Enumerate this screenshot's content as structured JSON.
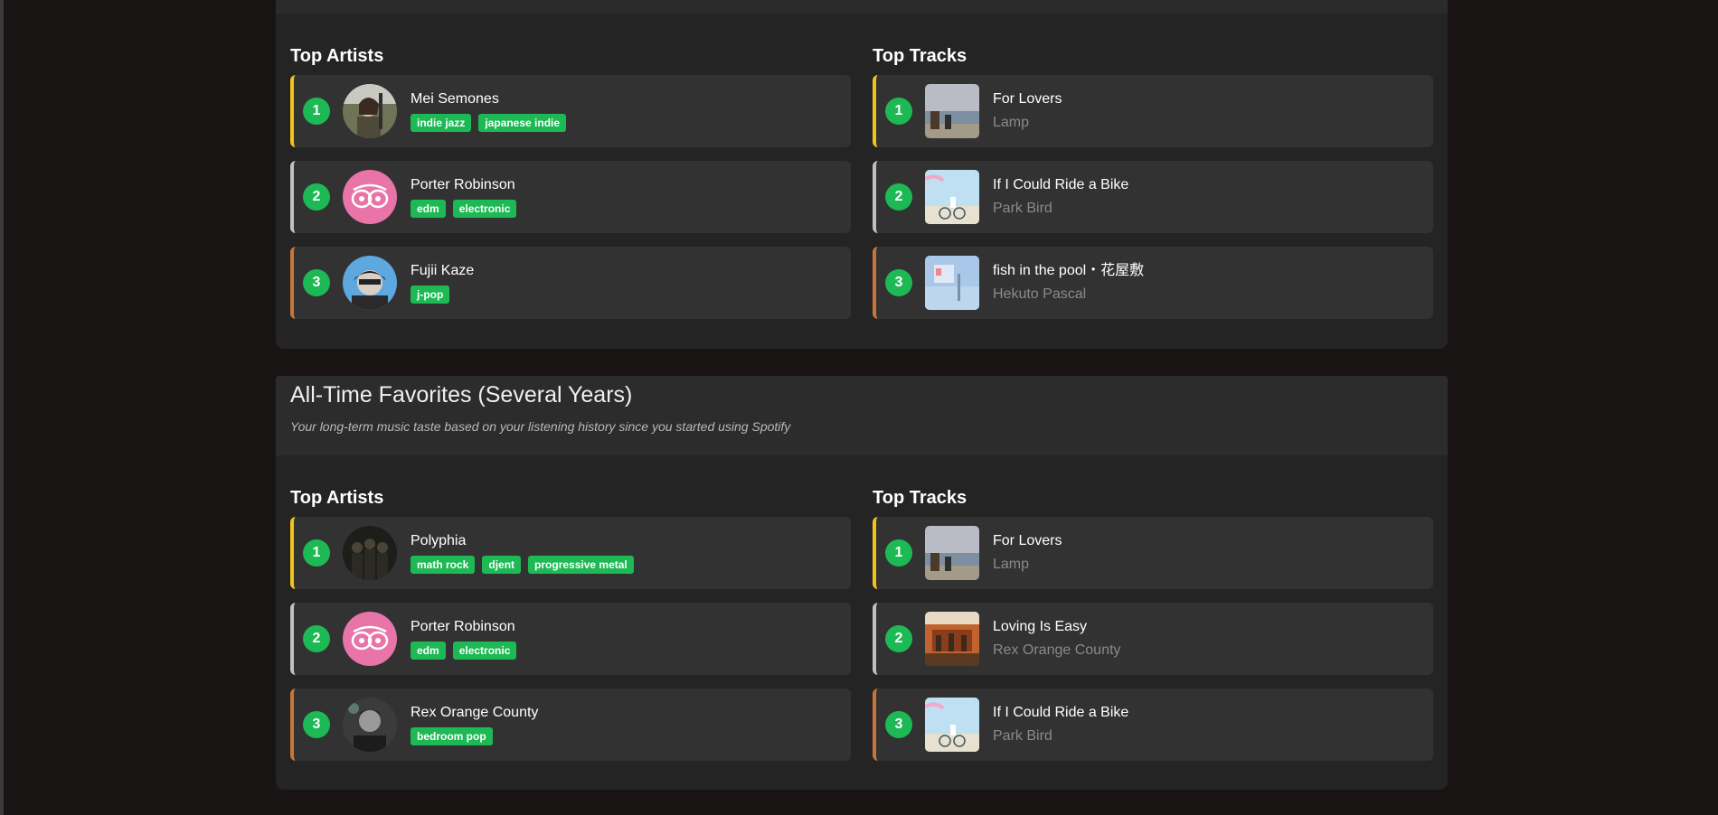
{
  "sections": [
    {
      "title": "",
      "subtitle": "",
      "artists_title": "Top Artists",
      "tracks_title": "Top Tracks",
      "artists": [
        {
          "rank": "1",
          "name": "Mei Semones",
          "tags": [
            "indie jazz",
            "japanese indie"
          ]
        },
        {
          "rank": "2",
          "name": "Porter Robinson",
          "tags": [
            "edm",
            "electronic"
          ]
        },
        {
          "rank": "3",
          "name": "Fujii Kaze",
          "tags": [
            "j-pop"
          ]
        }
      ],
      "tracks": [
        {
          "rank": "1",
          "title": "For Lovers",
          "artist": "Lamp"
        },
        {
          "rank": "2",
          "title": "If I Could Ride a Bike",
          "artist": "Park Bird"
        },
        {
          "rank": "3",
          "title": "fish in the pool・花屋敷",
          "artist": "Hekuto Pascal"
        }
      ]
    },
    {
      "title": "All-Time Favorites (Several Years)",
      "subtitle": "Your long-term music taste based on your listening history since you started using Spotify",
      "artists_title": "Top Artists",
      "tracks_title": "Top Tracks",
      "artists": [
        {
          "rank": "1",
          "name": "Polyphia",
          "tags": [
            "math rock",
            "djent",
            "progressive metal"
          ]
        },
        {
          "rank": "2",
          "name": "Porter Robinson",
          "tags": [
            "edm",
            "electronic"
          ]
        },
        {
          "rank": "3",
          "name": "Rex Orange County",
          "tags": [
            "bedroom pop"
          ]
        }
      ],
      "tracks": [
        {
          "rank": "1",
          "title": "For Lovers",
          "artist": "Lamp"
        },
        {
          "rank": "2",
          "title": "Loving Is Easy",
          "artist": "Rex Orange County"
        },
        {
          "rank": "3",
          "title": "If I Could Ride a Bike",
          "artist": "Park Bird"
        }
      ]
    }
  ],
  "colors": {
    "accent": "#1db954",
    "gold": "#f0c419",
    "silver": "#c0c0c0",
    "bronze": "#c6763a",
    "card": "#323232",
    "panel": "#242424",
    "page": "#181414"
  },
  "icons": {
    "artist_images": [
      "mei-semones-photo",
      "porter-robinson-photo",
      "fujii-kaze-photo",
      "polyphia-photo",
      "rex-orange-county-photo"
    ],
    "album_covers": [
      "lamp-for-lovers-cover",
      "park-bird-bike-cover",
      "hekuto-pascal-cover",
      "rex-orange-county-cover"
    ]
  }
}
